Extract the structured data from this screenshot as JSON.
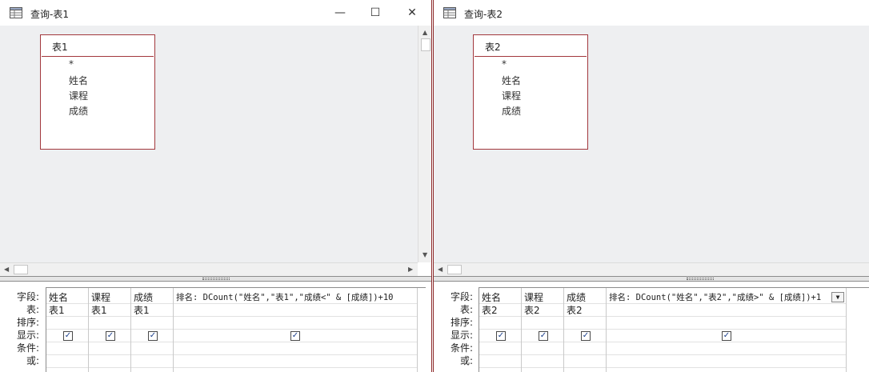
{
  "windows": [
    {
      "title": "查询-表1",
      "controls": {
        "minimize": "—",
        "maximize": "☐",
        "close": "✕"
      },
      "table": {
        "name": "表1",
        "fields": [
          "*",
          "姓名",
          "课程",
          "成绩"
        ]
      },
      "row_labels": [
        "字段:",
        "表:",
        "排序:",
        "显示:",
        "条件:",
        "或:"
      ],
      "columns": [
        {
          "field": "姓名",
          "table": "表1",
          "show": true
        },
        {
          "field": "课程",
          "table": "表1",
          "show": true
        },
        {
          "field": "成绩",
          "table": "表1",
          "show": true
        },
        {
          "field": "排名: DCount(\"姓名\",\"表1\",\"成绩<\" & [成绩])+10",
          "table": "",
          "show": true
        }
      ]
    },
    {
      "title": "查询-表2",
      "table": {
        "name": "表2",
        "fields": [
          "*",
          "姓名",
          "课程",
          "成绩"
        ]
      },
      "row_labels": [
        "字段:",
        "表:",
        "排序:",
        "显示:",
        "条件:",
        "或:"
      ],
      "columns": [
        {
          "field": "姓名",
          "table": "表2",
          "show": true
        },
        {
          "field": "课程",
          "table": "表2",
          "show": true
        },
        {
          "field": "成绩",
          "table": "表2",
          "show": true
        },
        {
          "field": "排名: DCount(\"姓名\",\"表2\",\"成绩>\" & [成绩])+1",
          "table": "",
          "show": true
        }
      ]
    }
  ],
  "icons": {
    "window": "query-icon",
    "checkbox": "checkbox-checked-icon",
    "dropdown": "dropdown-arrow-icon"
  },
  "colors": {
    "border_accent": "#a2383d",
    "design_bg": "#eeeff1"
  }
}
